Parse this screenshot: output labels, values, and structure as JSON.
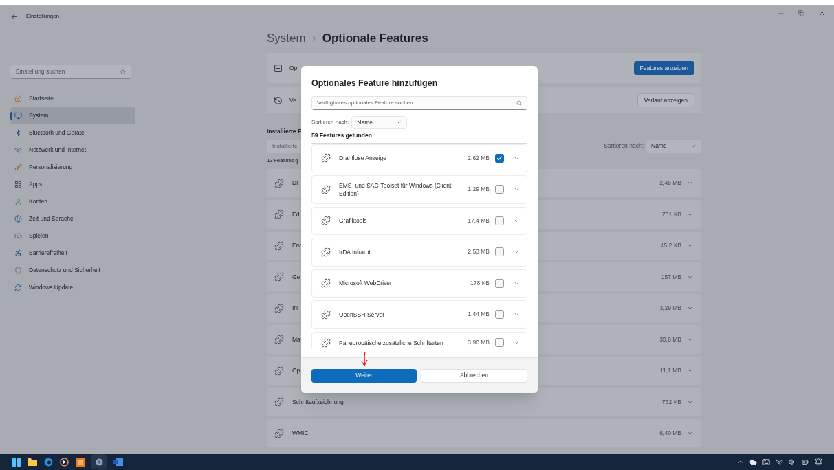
{
  "window": {
    "title": "Einstellungen"
  },
  "sidebar": {
    "search_placeholder": "Einstellung suchen",
    "items": [
      {
        "label": "Startseite",
        "selected": false
      },
      {
        "label": "System",
        "selected": true
      },
      {
        "label": "Bluetooth und Geräte",
        "selected": false
      },
      {
        "label": "Netzwerk und Internet",
        "selected": false
      },
      {
        "label": "Personalisierung",
        "selected": false
      },
      {
        "label": "Apps",
        "selected": false
      },
      {
        "label": "Konten",
        "selected": false
      },
      {
        "label": "Zeit und Sprache",
        "selected": false
      },
      {
        "label": "Spielen",
        "selected": false
      },
      {
        "label": "Barrierefreiheit",
        "selected": false
      },
      {
        "label": "Datenschutz und Sicherheit",
        "selected": false
      },
      {
        "label": "Windows Update",
        "selected": false
      }
    ]
  },
  "page": {
    "breadcrumb_parent": "System",
    "title": "Optionale Features",
    "cards": [
      {
        "label": "Op",
        "button": "Features anzeigen",
        "kind": "primary"
      },
      {
        "label": "Ve",
        "button": "Verlauf anzeigen",
        "kind": "secondary"
      }
    ],
    "installed": {
      "heading": "Installierte F",
      "search_placeholder": "Installierte",
      "count": "13 Features g",
      "sort_label": "Sortieren nach:",
      "sort_value": "Name",
      "rows": [
        {
          "name": "Dr",
          "size": "2,45 MB"
        },
        {
          "name": "Ed",
          "size": "731 KB"
        },
        {
          "name": "Erv",
          "size": "45,2 KB"
        },
        {
          "name": "Ge",
          "size": "157 MB"
        },
        {
          "name": "Int",
          "size": "3,29 MB"
        },
        {
          "name": "Ma",
          "size": "30,6 MB"
        },
        {
          "name": "Op",
          "size": "11,1 MB"
        },
        {
          "name": "Schrittaufzeichnung",
          "size": "762 KB"
        },
        {
          "name": "WMIC",
          "size": "6,40 MB"
        }
      ]
    }
  },
  "dialog": {
    "title": "Optionales Feature hinzufügen",
    "search_placeholder": "Verfügbares optionales Feature suchen",
    "sort_label": "Sortieren nach:",
    "sort_value": "Name",
    "count": "59 Features gefunden",
    "features": [
      {
        "name": "Drahtlose Anzeige",
        "size": "2,62 MB",
        "checked": true
      },
      {
        "name": "EMS- und SAC-Toolset für Windows (Client-Edition)",
        "size": "1,29 MB",
        "checked": false
      },
      {
        "name": "Grafiktools",
        "size": "17,4 MB",
        "checked": false
      },
      {
        "name": "IrDA Infrarot",
        "size": "2,53 MB",
        "checked": false
      },
      {
        "name": "Microsoft WebDriver",
        "size": "178 KB",
        "checked": false
      },
      {
        "name": "OpenSSH-Server",
        "size": "1,44 MB",
        "checked": false
      },
      {
        "name": "Paneuropäische zusätzliche Schriftarten",
        "size": "3,90 MB",
        "checked": false
      }
    ],
    "buttons": [
      {
        "label": "Weiter",
        "kind": "primary"
      },
      {
        "label": "Abbrechen",
        "kind": "secondary"
      }
    ]
  }
}
